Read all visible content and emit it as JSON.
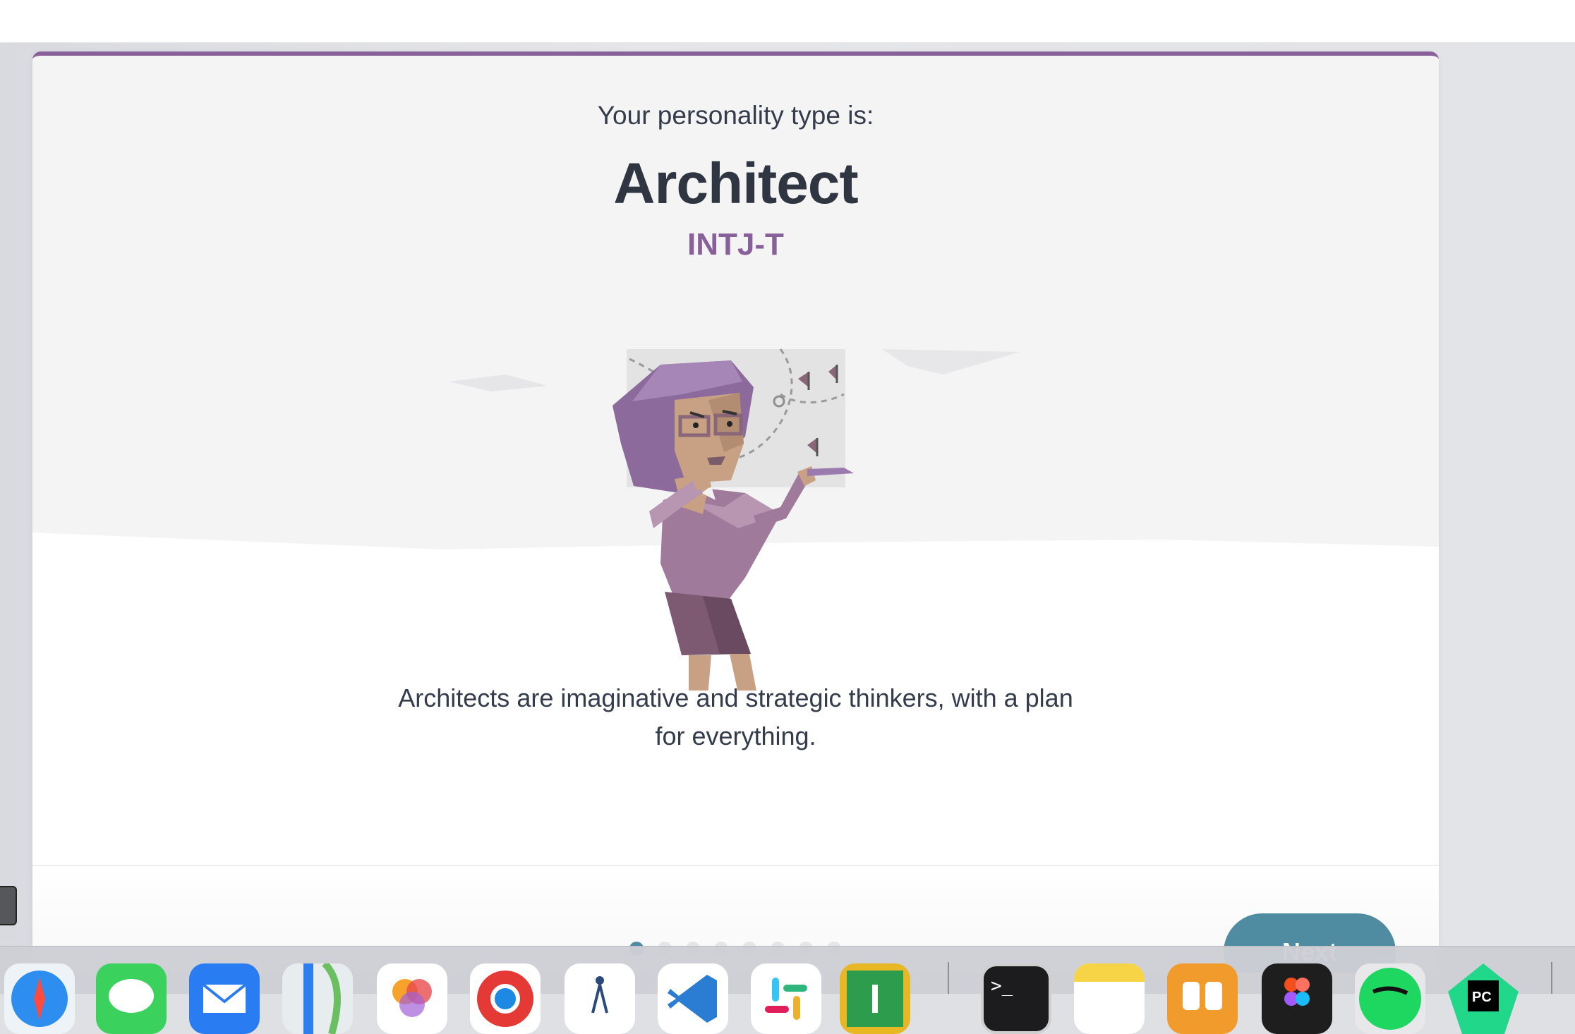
{
  "result": {
    "intro": "Your personality type is:",
    "type_name": "Architect",
    "type_code": "INTJ-T",
    "description_line1": "Architects are imaginative and strategic thinkers, with a plan",
    "description_line2": "for everything."
  },
  "footer": {
    "next_label": "Next",
    "pager": {
      "total": 8,
      "active": 1
    }
  },
  "colors": {
    "accent": "#88619a",
    "primary_button": "#4f8ba1",
    "heading": "#2f3541"
  },
  "dock": {
    "apps": [
      "safari-icon",
      "messages-icon",
      "mail-icon",
      "maps-icon",
      "photos-icon",
      "chrome-icon",
      "instruments-icon",
      "vscode-icon",
      "slack-icon",
      "numbers-icon",
      "terminal-icon",
      "notes-icon",
      "books-icon",
      "figma-icon",
      "spotify-icon",
      "pycharm-icon"
    ]
  }
}
